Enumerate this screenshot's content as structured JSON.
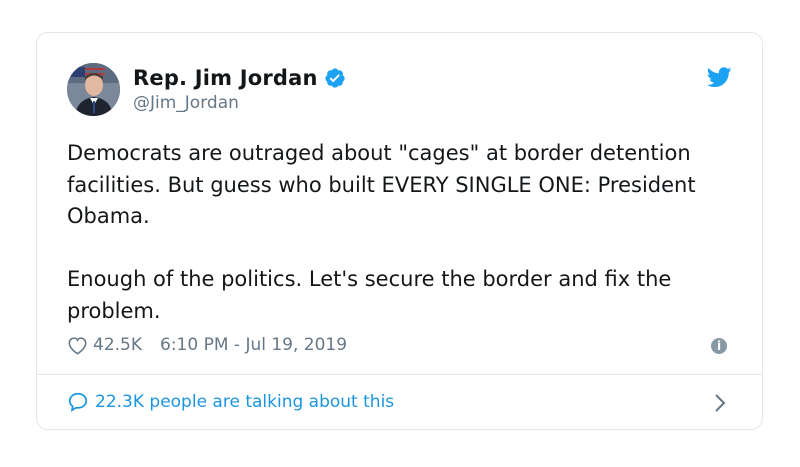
{
  "author": {
    "display_name": "Rep. Jim Jordan",
    "handle": "@Jim_Jordan"
  },
  "tweet": {
    "text": "Democrats are outraged about \"cages\" at border detention facilities. But guess who built EVERY SINGLE ONE: President Obama.\n\nEnough of the politics. Let's secure the border and fix the problem.",
    "likes": "42.5K",
    "timestamp": "6:10 PM - Jul 19, 2019"
  },
  "footer": {
    "talking_label": "22.3K people are talking about this"
  },
  "icons": {
    "verified": "verified-badge-icon",
    "brand": "twitter-bird-icon",
    "like": "heart-icon",
    "info": "info-icon",
    "reply": "speech-bubble-icon",
    "navigate": "chevron-right-icon"
  },
  "colors": {
    "accent": "#1da1f2",
    "link": "#1b95e0",
    "muted": "#657786"
  }
}
